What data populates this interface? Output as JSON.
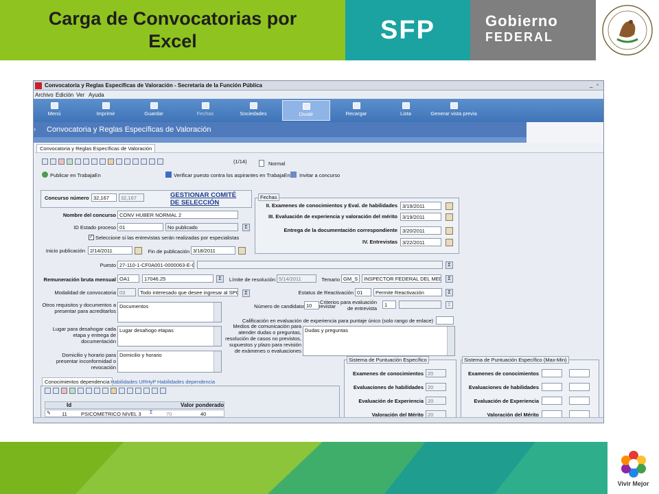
{
  "slide": {
    "title_line1": "Carga de Convocatorias por",
    "title_line2": "Excel",
    "sfp_logo": "SFP",
    "gobierno_line1": "Gobierno",
    "gobierno_line2": "FEDERAL",
    "footer_logo_text": "Vivir Mejor",
    "colors": {
      "title_bg": "#8fc31f",
      "sfp_bg": "#1aa3a1",
      "gobierno_bg": "#7f7f7f",
      "footer_green": "#7ab51d",
      "footer_teal": "#14a39c"
    }
  },
  "window": {
    "title": "Convocatoria y Reglas Específicas de Valoración - Secretaría de la Función Pública",
    "menu": [
      "Archivo",
      "Edición",
      "Ver",
      "Ayuda"
    ],
    "toolbar": [
      "Menú",
      "Imprimir",
      "Guardar",
      "Fechas",
      "Sociedades",
      "Dividir",
      "Recargar",
      "Lista",
      "Generar vista previa"
    ],
    "selected_toolbar": "Dividir",
    "band_title": "Convocatoria y Reglas Específicas de Valoración",
    "tab": "Convocatoria y Reglas Específicas de Valoración",
    "record_counter": "(1/14)",
    "normal_label": "Normal",
    "publish_label": "Publicar en TrabajaEn",
    "verify_label": "Verificar puesto contra los aspirantes en TrabajaEn",
    "invite_label": "Invitar a concurso"
  },
  "form": {
    "concurso_label": "Concurso número",
    "concurso_value": "32,167",
    "concurso_value_ro": "32,167",
    "gestionar_link": "GESTIONAR COMITÉ DE SELECCIÓN",
    "nombre_label": "Nombre del concurso",
    "nombre_value": "CONV HUBER NORMAL 2",
    "id_estado_label": "ID Estado proceso",
    "id_estado_value": "01",
    "estado_desc": "No publicado",
    "check_label": "Seleccione si las entrevistas serán realizadas por especialistas",
    "inicio_label": "Inicio publicación",
    "inicio_value": "2/14/2011",
    "fin_label": "Fin de publicación",
    "fin_value": "3/18/2011",
    "puesto_label": "Puesto",
    "puesto_value": "27-110-1-CF0A001-0000063-E-C-P",
    "remuneracion_label": "Remuneración bruta mensual",
    "rem_code": "OA1",
    "rem_value": "17046.25",
    "limite_label": "Límite de resolución",
    "limite_value": "5/14/2011",
    "temario_label": "Temario",
    "temario_code": "GM_S",
    "temario_value": "INSPECTOR FEDERAL DEL MEDI",
    "modalidad_label": "Modalidad de convocatoria",
    "modalidad_code": "03",
    "modalidad_value": "Todo interesado que desee ingresar al SPC",
    "estatus_label": "Estatus de Reactivación",
    "estatus_code": "01",
    "estatus_value": "Permite Reactivación",
    "otros_label": "Otros requisitos y documentos a presentar para acreditarlos",
    "otros_value": "Documentos",
    "num_candidatos_label": "Número de candidatos a entrevistar",
    "num_candidatos_value": "10",
    "criterios_label": "Criterios para evaluación de entrevista",
    "criterios_value": "1",
    "calificacion_label": "Calificación en evaluación de experiencia para puntaje único (solo rango de enlace)",
    "lugar_label": "Lugar para desahogar cada etapa y entrega de documentación",
    "lugar_value": "Lugar desahogo etapas",
    "medios_label": "Medios de comunicación para atender dudas o preguntas, resolución de casos no previstos, supuestos y plazo para revisión de exámenes o evaluaciones",
    "medios_value": "Dudas y preguntas",
    "domicilio_label": "Domicilio y horario para presentar inconformidad o revocación",
    "domicilio_value": "Domicilio y horario"
  },
  "fechas": {
    "legend": "Fechas",
    "rows": [
      {
        "label": "II. Examenes de conocimientos y Eval. de habilidades",
        "value": "3/19/2011"
      },
      {
        "label": "III. Evaluación de experiencia y valoración del mérito",
        "value": "3/19/2011"
      },
      {
        "label": "Entrega de la documentación correspondiente",
        "value": "3/20/2011"
      },
      {
        "label": "IV. Entrevistas",
        "value": "3/22/2011"
      }
    ]
  },
  "puntuacion": {
    "legend": "Sistema de Puntuación Específico",
    "rows": [
      {
        "label": "Examenes de conocimientos",
        "value": "20"
      },
      {
        "label": "Evaluaciones de habilidades",
        "value": "20"
      },
      {
        "label": "Evaluación de Experiencia",
        "value": "20"
      },
      {
        "label": "Valoración del Mérito",
        "value": "20"
      }
    ]
  },
  "puntuacion_mm": {
    "legend": "Sistema de Puntuación Específico (Max-Min)",
    "rows": [
      {
        "label": "Examenes de conocimientos"
      },
      {
        "label": "Evaluaciones de habilidades"
      },
      {
        "label": "Evaluación de Experiencia"
      },
      {
        "label": "Valoración del Mérito"
      }
    ]
  },
  "subtabs": [
    "Conocimientos dependencia",
    "Habilidades URHyP",
    "Habilidades dependencia"
  ],
  "subgrid": {
    "col_id": "Id",
    "col_valor": "Valor ponderado",
    "row_id": "11",
    "row_name": "PSICOMETRICO NIVEL 3",
    "row_num": "70",
    "row_valor": "40"
  }
}
